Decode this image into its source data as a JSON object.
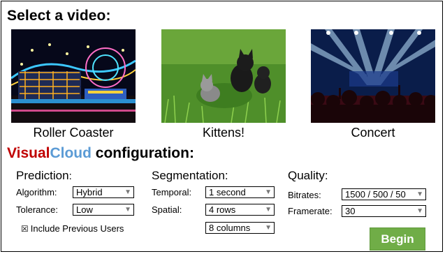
{
  "select_video": {
    "title": "Select a video:",
    "videos": [
      {
        "caption": "Roller Coaster"
      },
      {
        "caption": "Kittens!"
      },
      {
        "caption": "Concert"
      }
    ]
  },
  "config": {
    "brand_visual": "Visual",
    "brand_cloud": "Cloud",
    "title_rest": " configuration:",
    "colors": {
      "visual": "#c00000",
      "cloud": "#5b9bd5",
      "begin": "#70ad47"
    }
  },
  "prediction": {
    "heading": "Prediction",
    "heading_colon": ":",
    "algorithm_label": "Algorithm:",
    "algorithm_value": "Hybrid",
    "tolerance_label": "Tolerance:",
    "tolerance_value": "Low",
    "include_previous_label": "Include Previous Users",
    "include_previous_checked": true
  },
  "segmentation": {
    "heading": "Segmentation:",
    "temporal_label": "Temporal:",
    "temporal_value": "1 second",
    "spatial_label": "Spatial:",
    "spatial_rows_value": "4 rows",
    "spatial_columns_value": "8 columns"
  },
  "quality": {
    "heading": "Quality:",
    "bitrates_label": "Bitrates:",
    "bitrates_value": "1500 / 500 / 50",
    "framerate_label": "Framerate:",
    "framerate_value": "30"
  },
  "begin_label": "Begin"
}
